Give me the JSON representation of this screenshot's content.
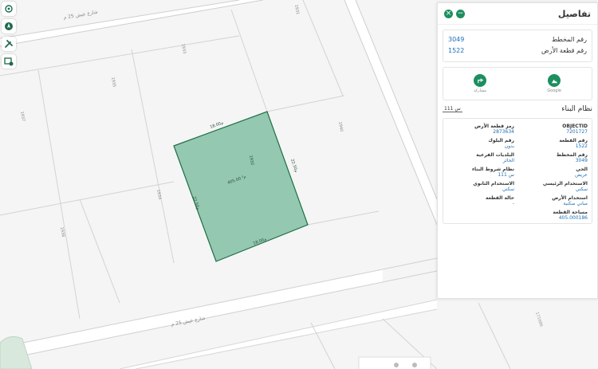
{
  "map": {
    "street_top": "شارع عيش 25 م",
    "street_bottom": "شارع عيش 25 م",
    "parcel_numbers": [
      "1933",
      "1935",
      "1937",
      "1931",
      "1932",
      "1936",
      "1934",
      "1938",
      "1940",
      "1932"
    ],
    "selected_parcel": {
      "number": "1932",
      "area_label": "405.00 م²",
      "dim_top": "18.00م",
      "dim_bottom": "18.00م",
      "dim_left": "22.50م",
      "dim_right": "22.50م"
    },
    "bottom_right_number": "171686",
    "selected_fill": "#94c8b0",
    "selected_stroke": "#1e6e46"
  },
  "panel": {
    "title": "تفاصيل",
    "info": [
      {
        "label": "رقم المخطط",
        "value": "3049"
      },
      {
        "label": "رقم قطعة الأرض",
        "value": "1522"
      }
    ],
    "share_buttons": [
      {
        "icon": "map-icon",
        "label": "Google"
      },
      {
        "icon": "share-icon",
        "label": "مشاركة"
      }
    ],
    "building_system_label": "نظام البناء",
    "building_system_value": "س 111",
    "attributes": [
      {
        "label": "OBJECTID",
        "value": "7201727"
      },
      {
        "label": "رمز قطعة الأرض",
        "value": "2873634"
      },
      {
        "label": "رقم القطعة",
        "value": "1522"
      },
      {
        "label": "رقم البلوك",
        "value": "بدون"
      },
      {
        "label": "رقم المخطط",
        "value": "3049"
      },
      {
        "label": "البلديات الفرعية",
        "value": "الحائر"
      },
      {
        "label": "الحي",
        "value": "عريض"
      },
      {
        "label": "نظام شروط البناء",
        "value": "س 111"
      },
      {
        "label": "الاستخدام الرئيسي",
        "value": "سكني"
      },
      {
        "label": "الاستخدام الثانوي",
        "value": "سكني"
      },
      {
        "label": "استخدام الأرض",
        "value": "مباني سكنية"
      },
      {
        "label": "حالة القطعة",
        "value": "-"
      },
      {
        "label": "مساحة القطعة",
        "value": "405.000186"
      }
    ]
  }
}
